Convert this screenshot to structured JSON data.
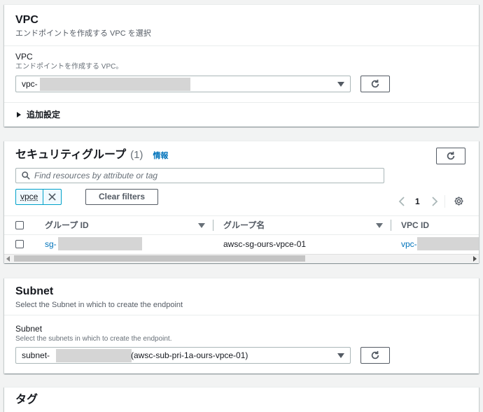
{
  "vpc_section": {
    "title": "VPC",
    "description": "エンドポイントを作成する VPC を選択",
    "field_label": "VPC",
    "field_desc": "エンドポイントを作成する VPC。",
    "selected_prefix": "vpc-",
    "additional_settings": "追加設定"
  },
  "sg_section": {
    "title": "セキュリティグループ",
    "count": "(1)",
    "info": "情報",
    "search_placeholder": "Find resources by attribute or tag",
    "filter_token": "vpce",
    "clear_filters": "Clear filters",
    "page_number": "1",
    "columns": [
      "グループ ID",
      "グループ名",
      "VPC ID"
    ],
    "rows": [
      {
        "group_id_prefix": "sg-",
        "group_name": "awsc-sg-ours-vpce-01",
        "vpc_id_prefix": "vpc-"
      }
    ]
  },
  "subnet_section": {
    "title": "Subnet",
    "description": "Select the Subnet in which to create the endpoint",
    "field_label": "Subnet",
    "field_desc": "Select the subnets in which to create the endpoint.",
    "selected_prefix": "subnet-",
    "selected_suffix": "(awsc-sub-pri-1a-ours-vpce-01)"
  },
  "tags_section": {
    "title": "タグ"
  },
  "icons": [
    "refresh-icon",
    "search-icon",
    "close-icon",
    "chevron-left-icon",
    "chevron-right-icon",
    "settings-icon",
    "caret-right-icon",
    "caret-down-icon",
    "sort-icon"
  ],
  "colors": {
    "link": "#0073bb",
    "token_border": "#00a1c9",
    "background": "#f2f3f3"
  }
}
